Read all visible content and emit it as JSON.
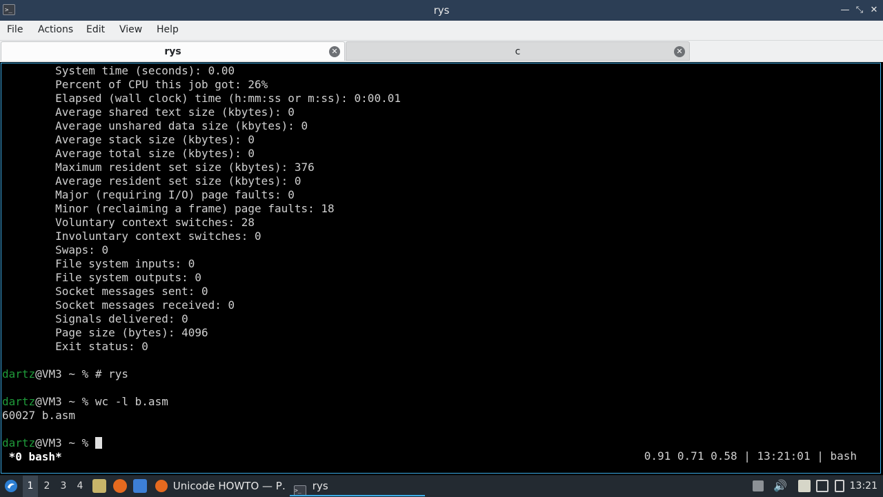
{
  "window": {
    "title": "rys",
    "app_icon": ">_",
    "icons": {
      "app": "terminal-icon",
      "minimize": "minimize-icon",
      "maximize": "maximize-icon",
      "close": "close-icon"
    }
  },
  "menubar": {
    "items": [
      "File",
      "Actions",
      "Edit",
      "View",
      "Help"
    ]
  },
  "tabs": [
    {
      "label": "rys",
      "active": true
    },
    {
      "label": "c",
      "active": false
    }
  ],
  "terminal": {
    "lines": [
      "        System time (seconds): 0.00",
      "        Percent of CPU this job got: 26%",
      "        Elapsed (wall clock) time (h:mm:ss or m:ss): 0:00.01",
      "        Average shared text size (kbytes): 0",
      "        Average unshared data size (kbytes): 0",
      "        Average stack size (kbytes): 0",
      "        Average total size (kbytes): 0",
      "        Maximum resident set size (kbytes): 376",
      "        Average resident set size (kbytes): 0",
      "        Major (requiring I/O) page faults: 0",
      "        Minor (reclaiming a frame) page faults: 18",
      "        Voluntary context switches: 28",
      "        Involuntary context switches: 0",
      "        Swaps: 0",
      "        File system inputs: 0",
      "        File system outputs: 0",
      "        Socket messages sent: 0",
      "        Socket messages received: 0",
      "        Signals delivered: 0",
      "        Page size (bytes): 4096",
      "        Exit status: 0"
    ],
    "prompts": [
      {
        "user": "dartz",
        "rest": "@VM3 ~ % # rys"
      },
      {
        "user": "dartz",
        "rest": "@VM3 ~ % wc -l b.asm"
      },
      {
        "user": "dartz",
        "rest": "@VM3 ~ % "
      }
    ],
    "output_wc": "60027 b.asm",
    "status_left": " *0 bash*",
    "status_right": "0.91 0.71 0.58 | 13:21:01 | bash",
    "colors": {
      "user": "#1f9b3a",
      "border": "#3daee9"
    }
  },
  "taskbar": {
    "desktops": [
      "1",
      "2",
      "3",
      "4"
    ],
    "active_desktop": "1",
    "tasks": [
      {
        "label": "Unicode HOWTO — P…",
        "icon": "firefox-icon"
      },
      {
        "label": "rys",
        "icon": "terminal-icon"
      }
    ],
    "clock": "13:21",
    "icons": [
      "start-menu-icon",
      "file-manager-icon",
      "firefox-icon",
      "show-desktop-icon",
      "tray-up-arrow-icon",
      "volume-icon",
      "clipboard-icon",
      "screen-icon",
      "battery-icon"
    ]
  }
}
